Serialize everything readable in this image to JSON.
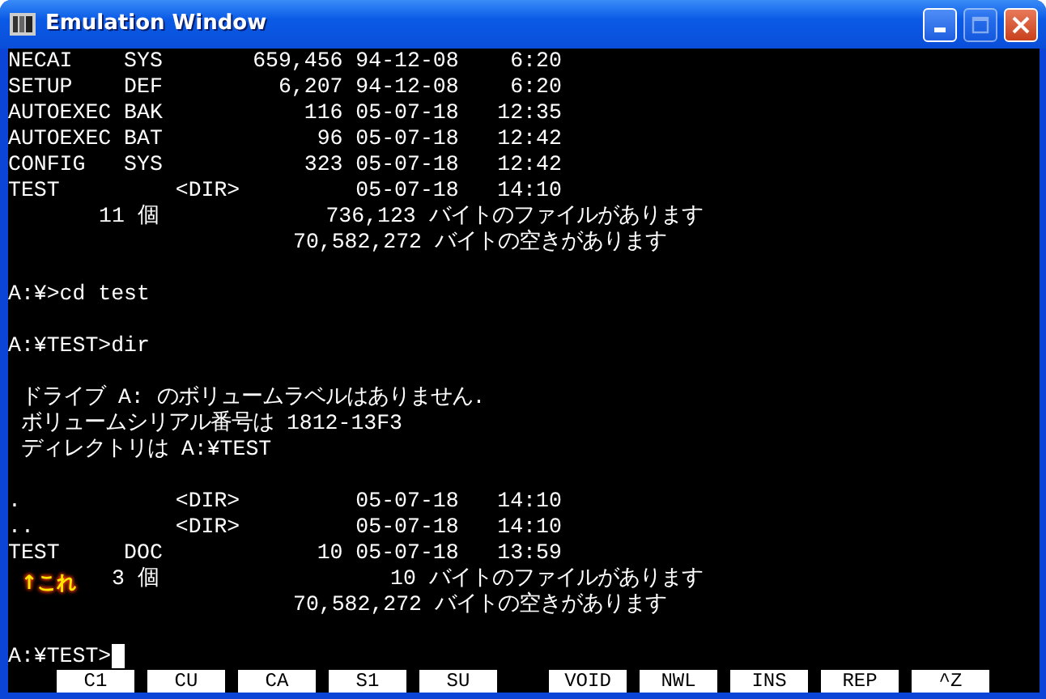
{
  "window": {
    "title": "Emulation Window",
    "maximize_disabled": true
  },
  "terminal": {
    "blocks": [
      [
        "NECAI    SYS       659,456 94-12-08    6:20",
        "SETUP    DEF         6,207 94-12-08    6:20",
        "AUTOEXEC BAK           116 05-07-18   12:35",
        "AUTOEXEC BAT            96 05-07-18   12:42",
        "CONFIG   SYS           323 05-07-18   12:42",
        "TEST         <DIR>         05-07-18   14:10",
        "       11 個             736,123 バイトのファイルがあります",
        "                      70,582,272 バイトの空きがあります"
      ],
      [
        "A:¥>cd test"
      ],
      [
        "A:¥TEST>dir"
      ],
      [
        " ドライブ A: のボリュームラベルはありません.",
        " ボリュームシリアル番号は 1812-13F3",
        " ディレクトリは A:¥TEST"
      ],
      [
        ".            <DIR>         05-07-18   14:10",
        "..           <DIR>         05-07-18   14:10",
        "TEST     DOC            10 05-07-18   13:59",
        "        3 個                  10 バイトのファイルがあります",
        "                      70,582,272 バイトの空きがあります"
      ],
      [
        "A:¥TEST>"
      ]
    ],
    "cursor": true,
    "annotation": "↑これ"
  },
  "function_keys": [
    [
      "C1",
      "CU",
      "CA",
      "S1",
      "SU"
    ],
    [
      "VOID",
      "NWL",
      "INS",
      "REP",
      "^Z"
    ]
  ]
}
